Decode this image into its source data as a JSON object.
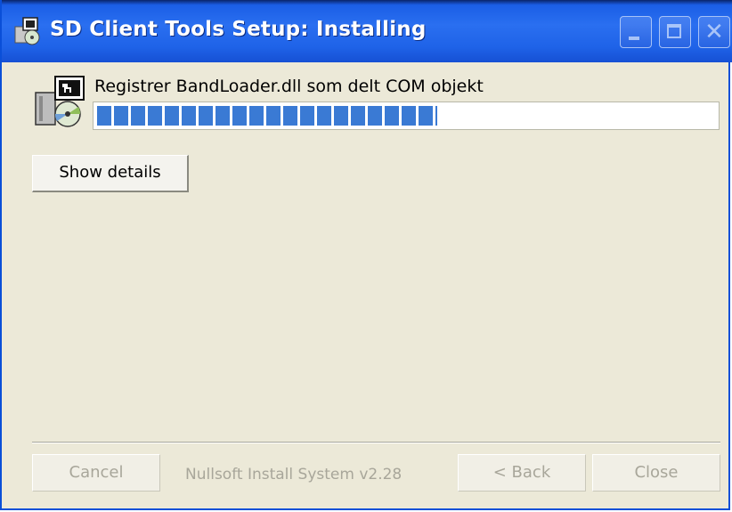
{
  "window": {
    "title": "SD Client Tools Setup: Installing",
    "title_icon": "installer-icon",
    "controls": {
      "minimize_icon": "minimize-icon",
      "maximize_icon": "maximize-icon",
      "close_glyph": "✕"
    }
  },
  "status": {
    "text": "Registrer BandLoader.dll som delt COM objekt",
    "icon": "setup-package-icon"
  },
  "progress": {
    "fraction": 0.55
  },
  "buttons": {
    "show_details": "Show details",
    "cancel": "Cancel",
    "back": "< Back",
    "close": "Close"
  },
  "branding": "Nullsoft Install System v2.28",
  "colors": {
    "titlebar": "#2a6ff0",
    "progress_fill": "#3a7ad4",
    "dialog_bg": "#ece9d8",
    "disabled_text": "#a8a69a"
  }
}
